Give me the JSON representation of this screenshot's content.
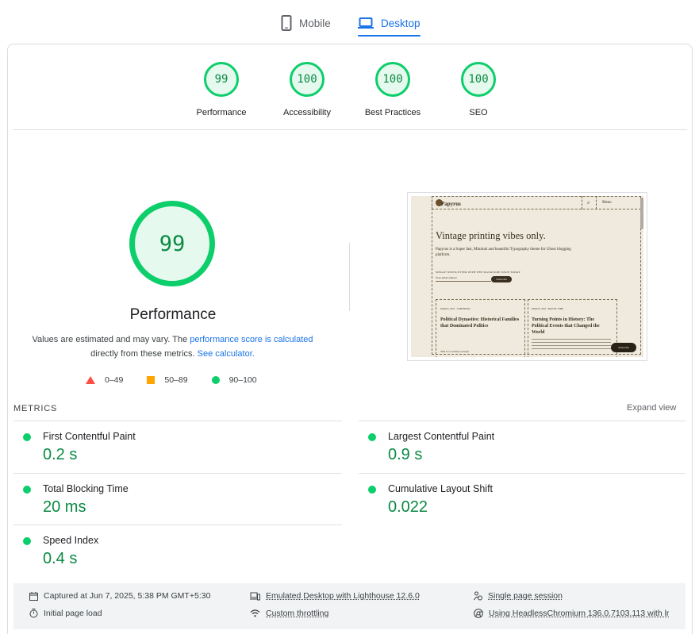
{
  "tabs": [
    {
      "label": "Mobile",
      "icon": "phone-icon",
      "active": false
    },
    {
      "label": "Desktop",
      "icon": "laptop-icon",
      "active": true
    }
  ],
  "category_scores": [
    {
      "score": "99",
      "label": "Performance"
    },
    {
      "score": "100",
      "label": "Accessibility"
    },
    {
      "score": "100",
      "label": "Best Practices"
    },
    {
      "score": "100",
      "label": "SEO"
    }
  ],
  "performance": {
    "score": "99",
    "title": "Performance",
    "note_1": "Values are estimated and may vary. The ",
    "note_link_1": "performance score is calculated",
    "note_2": " directly from these metrics. ",
    "note_link_2": "See calculator.",
    "legend": [
      {
        "range": "0–49",
        "shape": "triangle",
        "color": "#ff4e42"
      },
      {
        "range": "50–89",
        "shape": "square",
        "color": "#ffa400"
      },
      {
        "range": "90–100",
        "shape": "circle",
        "color": "#0cce6b"
      }
    ]
  },
  "thumbnail": {
    "logo": "Papyrus",
    "menu": "Menu",
    "headline": "Vintage printing vibes only.",
    "tagline": "Papyrus is a Super fast, Minimal and beautiful Typography theme for Ghost blogging platform.",
    "newsletter_label": "SINGLE NEWSLETTER WITH THE SIGNATURE ISSUE TODAY",
    "email_placeholder": "Your email address",
    "subscribe_button": "Subscribe",
    "post_1_meta": "MAR 05, 2025 · 3 MIN READ",
    "post_1_title": "Political Dynasties: Historical Families that Dominated Politics",
    "post_1_excerpt": "This is a courtesy excerpt",
    "post_2_meta": "MAR 05, 2025 · POLITIC TIME",
    "post_2_title": "Turning Points in History: The Political Events that Changed the World",
    "floating_button": "Subscribe"
  },
  "metrics": {
    "title": "METRICS",
    "expand_label": "Expand view",
    "items": [
      {
        "name": "First Contentful Paint",
        "value": "0.2 s"
      },
      {
        "name": "Largest Contentful Paint",
        "value": "0.9 s"
      },
      {
        "name": "Total Blocking Time",
        "value": "20 ms"
      },
      {
        "name": "Cumulative Layout Shift",
        "value": "0.022"
      },
      {
        "name": "Speed Index",
        "value": "0.4 s"
      }
    ]
  },
  "run_info": {
    "captured": "Captured at Jun 7, 2025, 5:38 PM GMT+5:30",
    "load": "Initial page load",
    "device": "Emulated Desktop with Lighthouse 12.6.0",
    "throttling": "Custom throttling",
    "session": "Single page session",
    "browser": "Using HeadlessChromium 136.0.7103.113 with lr"
  },
  "colors": {
    "pass": "#0cce6b",
    "pass_text": "#0a8a44",
    "accent": "#1a73e8"
  }
}
